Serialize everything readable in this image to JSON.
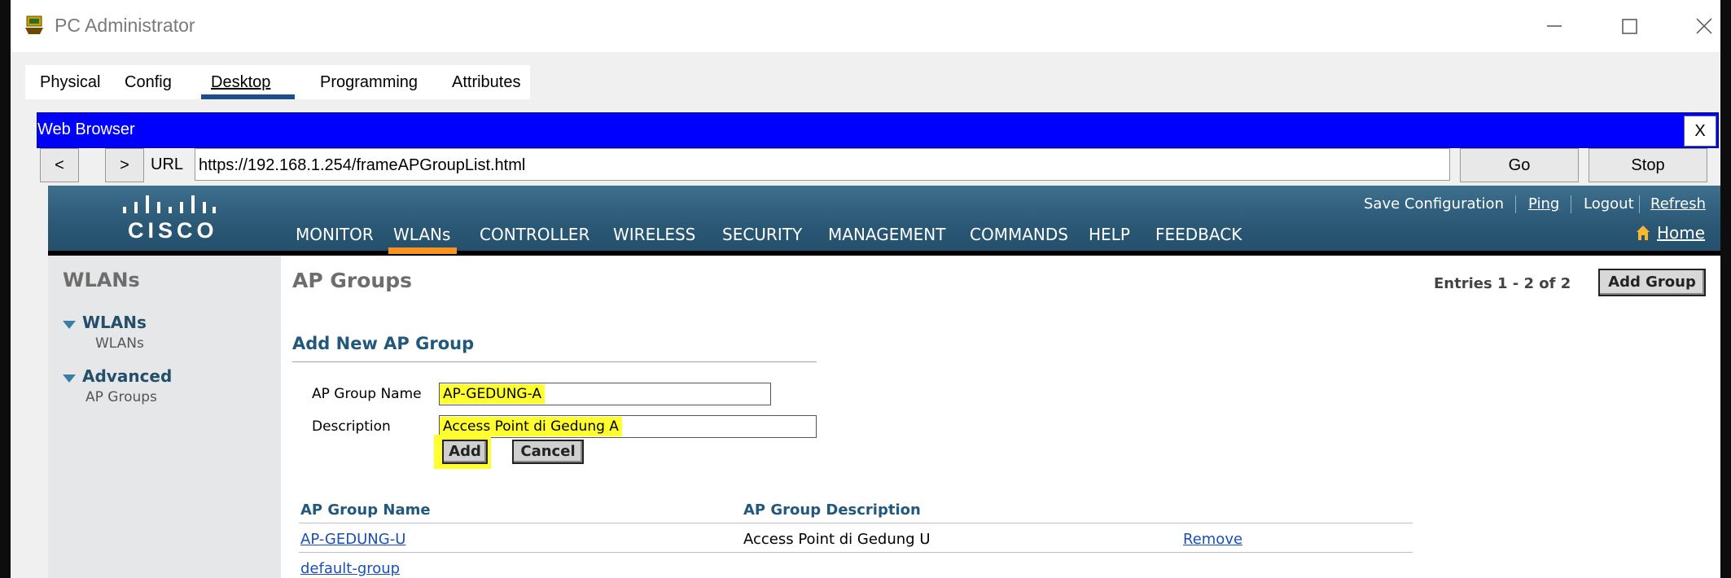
{
  "window": {
    "title": "PC Administrator"
  },
  "tabs": [
    "Physical",
    "Config",
    "Desktop",
    "Programming",
    "Attributes"
  ],
  "active_tab": "Desktop",
  "browser": {
    "title": "Web Browser",
    "close_label": "X",
    "back_label": "<",
    "forward_label": ">",
    "url_label": "URL",
    "url": "https://192.168.1.254/frameAPGroupList.html",
    "go_label": "Go",
    "stop_label": "Stop"
  },
  "cisco": {
    "logo_text": "CISCO",
    "top_links": [
      "Save Configuration",
      "Ping",
      "Logout",
      "Refresh"
    ],
    "menu": [
      "MONITOR",
      "WLANs",
      "CONTROLLER",
      "WIRELESS",
      "SECURITY",
      "MANAGEMENT",
      "COMMANDS",
      "HELP",
      "FEEDBACK"
    ],
    "active_menu": "WLANs",
    "home_label": "Home"
  },
  "sidebar": {
    "title": "WLANs",
    "groups": [
      {
        "label": "WLANs",
        "items": [
          "WLANs"
        ]
      },
      {
        "label": "Advanced",
        "items": [
          "AP Groups"
        ]
      }
    ]
  },
  "main": {
    "title": "AP Groups",
    "entries": "Entries 1 - 2 of 2",
    "add_group_label": "Add Group",
    "add_section": {
      "title": "Add New AP Group",
      "name_label": "AP Group Name",
      "name_value": "AP-GEDUNG-A",
      "desc_label": "Description",
      "desc_value": "Access Point di Gedung A",
      "add_label": "Add",
      "cancel_label": "Cancel"
    },
    "table": {
      "headers": [
        "AP Group Name",
        "AP Group Description"
      ],
      "rows": [
        {
          "name": "AP-GEDUNG-U",
          "description": "Access Point di Gedung U",
          "action": "Remove"
        },
        {
          "name": "default-group",
          "description": "",
          "action": ""
        }
      ]
    }
  },
  "colors": {
    "browser_bar": "#0000ff",
    "cisco_header": "#2a5875",
    "active_orange": "#f7941d",
    "highlight": "#ffff30"
  }
}
